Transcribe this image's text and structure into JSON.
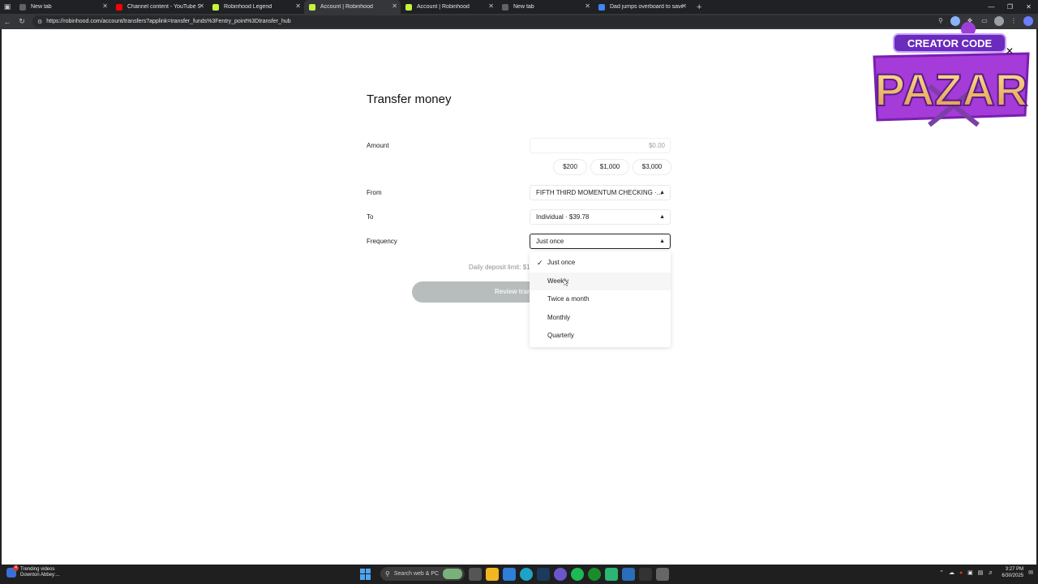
{
  "browser": {
    "tabs": [
      {
        "label": "New tab",
        "favicon_color": "#5f6368",
        "active": false
      },
      {
        "label": "Channel content - YouTube Studio",
        "favicon_color": "#ff0000",
        "active": false
      },
      {
        "label": "Robinhood Legend",
        "favicon_color": "#c3f53c",
        "active": false
      },
      {
        "label": "Account | Robinhood",
        "favicon_color": "#c3f53c",
        "active": true
      },
      {
        "label": "Account | Robinhood",
        "favicon_color": "#c3f53c",
        "active": false
      },
      {
        "label": "New tab",
        "favicon_color": "#5f6368",
        "active": false
      },
      {
        "label": "Dad jumps overboard to save daughter",
        "favicon_color": "#4285f4",
        "active": false
      }
    ],
    "url": "https://robinhood.com/account/transfers?applink=transfer_funds%3Fentry_point%3Dtransfer_hub"
  },
  "transfer": {
    "title": "Transfer money",
    "amount_label": "Amount",
    "amount_placeholder": "$0.00",
    "presets": [
      "$200",
      "$1,000",
      "$3,000"
    ],
    "from_label": "From",
    "from_value": "FIFTH THIRD MOMENTUM CHECKING ·...",
    "to_label": "To",
    "to_value": "Individual · $39.78",
    "frequency_label": "Frequency",
    "frequency_value": "Just once",
    "limit_text": "Daily deposit limit: $1",
    "review_label": "Review transfer"
  },
  "frequency_menu": {
    "options": [
      "Just once",
      "Weekly",
      "Twice a month",
      "Monthly",
      "Quarterly"
    ],
    "selected": "Just once",
    "hovered": "Weekly"
  },
  "overlay": {
    "logo_top": "CREATOR CODE",
    "logo_main": "PAZAR"
  },
  "taskbar": {
    "widget_title": "Trending videos",
    "widget_sub": "Downton Abbey:...",
    "widget_badge": "4",
    "search_placeholder": "Search web & PC",
    "time": "3:27 PM",
    "date": "6/30/2025"
  },
  "colors": {
    "accent": "#c3f53c",
    "button_disabled": "#b7bdbd"
  }
}
